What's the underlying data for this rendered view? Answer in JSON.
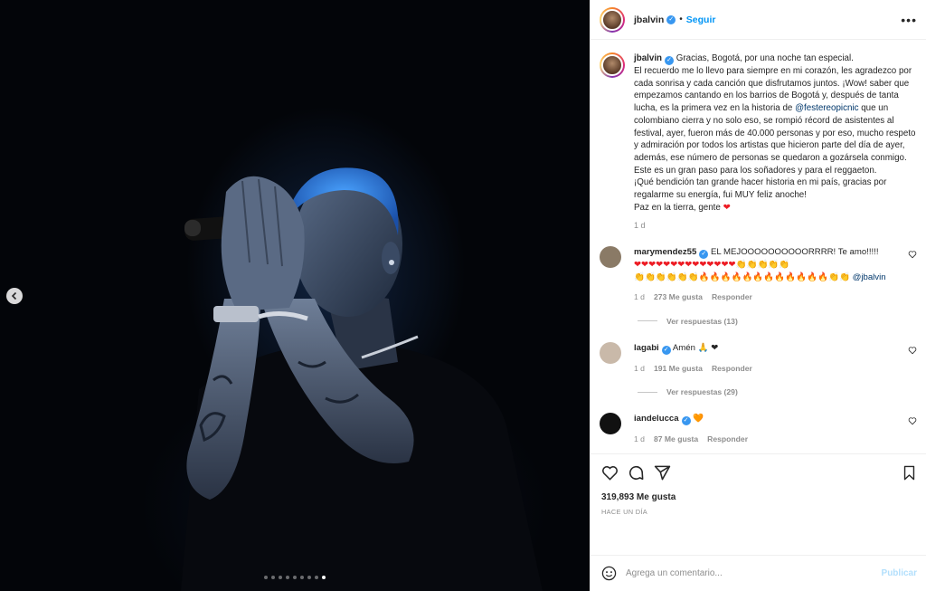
{
  "post": {
    "username": "jbalvin",
    "follow_label": "Seguir",
    "separator": "•",
    "more_label": "•••",
    "carousel": {
      "total": 9,
      "active_index": 8
    }
  },
  "caption": {
    "username": "jbalvin",
    "lines": [
      "Gracias, Bogotá, por una noche tan especial.",
      "El recuerdo me lo llevo para siempre en mi corazón, les agradezco por cada sonrisa y cada canción que disfrutamos juntos. ¡Wow! saber que empezamos cantando en los barrios de Bogotá y, después de tanta lucha, es la primera vez en la historia de"
    ],
    "mention": "@festereopicnic",
    "rest": " que un colombiano cierra y no solo eso, se rompió récord de asistentes al festival, ayer, fueron más de 40.000 personas y por eso, mucho respeto y admiración por todos los artistas que hicieron parte del día de ayer, además, ese número de personas se quedaron a gozársela conmigo.",
    "line3": "Este es un gran paso para los soñadores y para el reggaeton.",
    "line4": "¡Qué bendición tan grande hacer historia en mi país, gracias por regalarme su energía, fui MUY feliz anoche!",
    "line5": "Paz en la tierra, gente ",
    "heart": "❤",
    "time": "1 d"
  },
  "comments": [
    {
      "username": "marymendez55",
      "verified": true,
      "text": " EL MEJOOOOOOOOOORRRR! Te amo!!!!!",
      "hearts": "❤❤❤❤❤❤❤❤❤❤❤❤❤❤",
      "claps": "👏👏👏👏👏",
      "claps2": "👏👏👏👏👏👏",
      "fires": "🔥🔥🔥🔥🔥🔥🔥🔥🔥🔥🔥🔥",
      "claps3": "👏👏 ",
      "mention": "@jbalvin",
      "time": "1 d",
      "likes": "273 Me gusta",
      "reply": "Responder",
      "replies": "Ver respuestas (13)",
      "avatar_color": "#8a7a66"
    },
    {
      "username": "lagabi",
      "verified": true,
      "text": " Amén 🙏 ❤",
      "time": "1 d",
      "likes": "191 Me gusta",
      "reply": "Responder",
      "replies": "Ver respuestas (29)",
      "avatar_color": "#c9b9a9"
    },
    {
      "username": "iandelucca",
      "verified": true,
      "text": " 🧡",
      "time": "1 d",
      "likes": "87 Me gusta",
      "reply": "Responder",
      "avatar_color": "#111111"
    }
  ],
  "actions": {
    "likes": "319,893 Me gusta",
    "when": "HACE UN DÍA"
  },
  "add_comment": {
    "placeholder": "Agrega un comentario...",
    "publish": "Publicar"
  },
  "colors": {
    "accent": "#0095f6",
    "verified": "#3897f0",
    "heart": "#ed1c24"
  }
}
